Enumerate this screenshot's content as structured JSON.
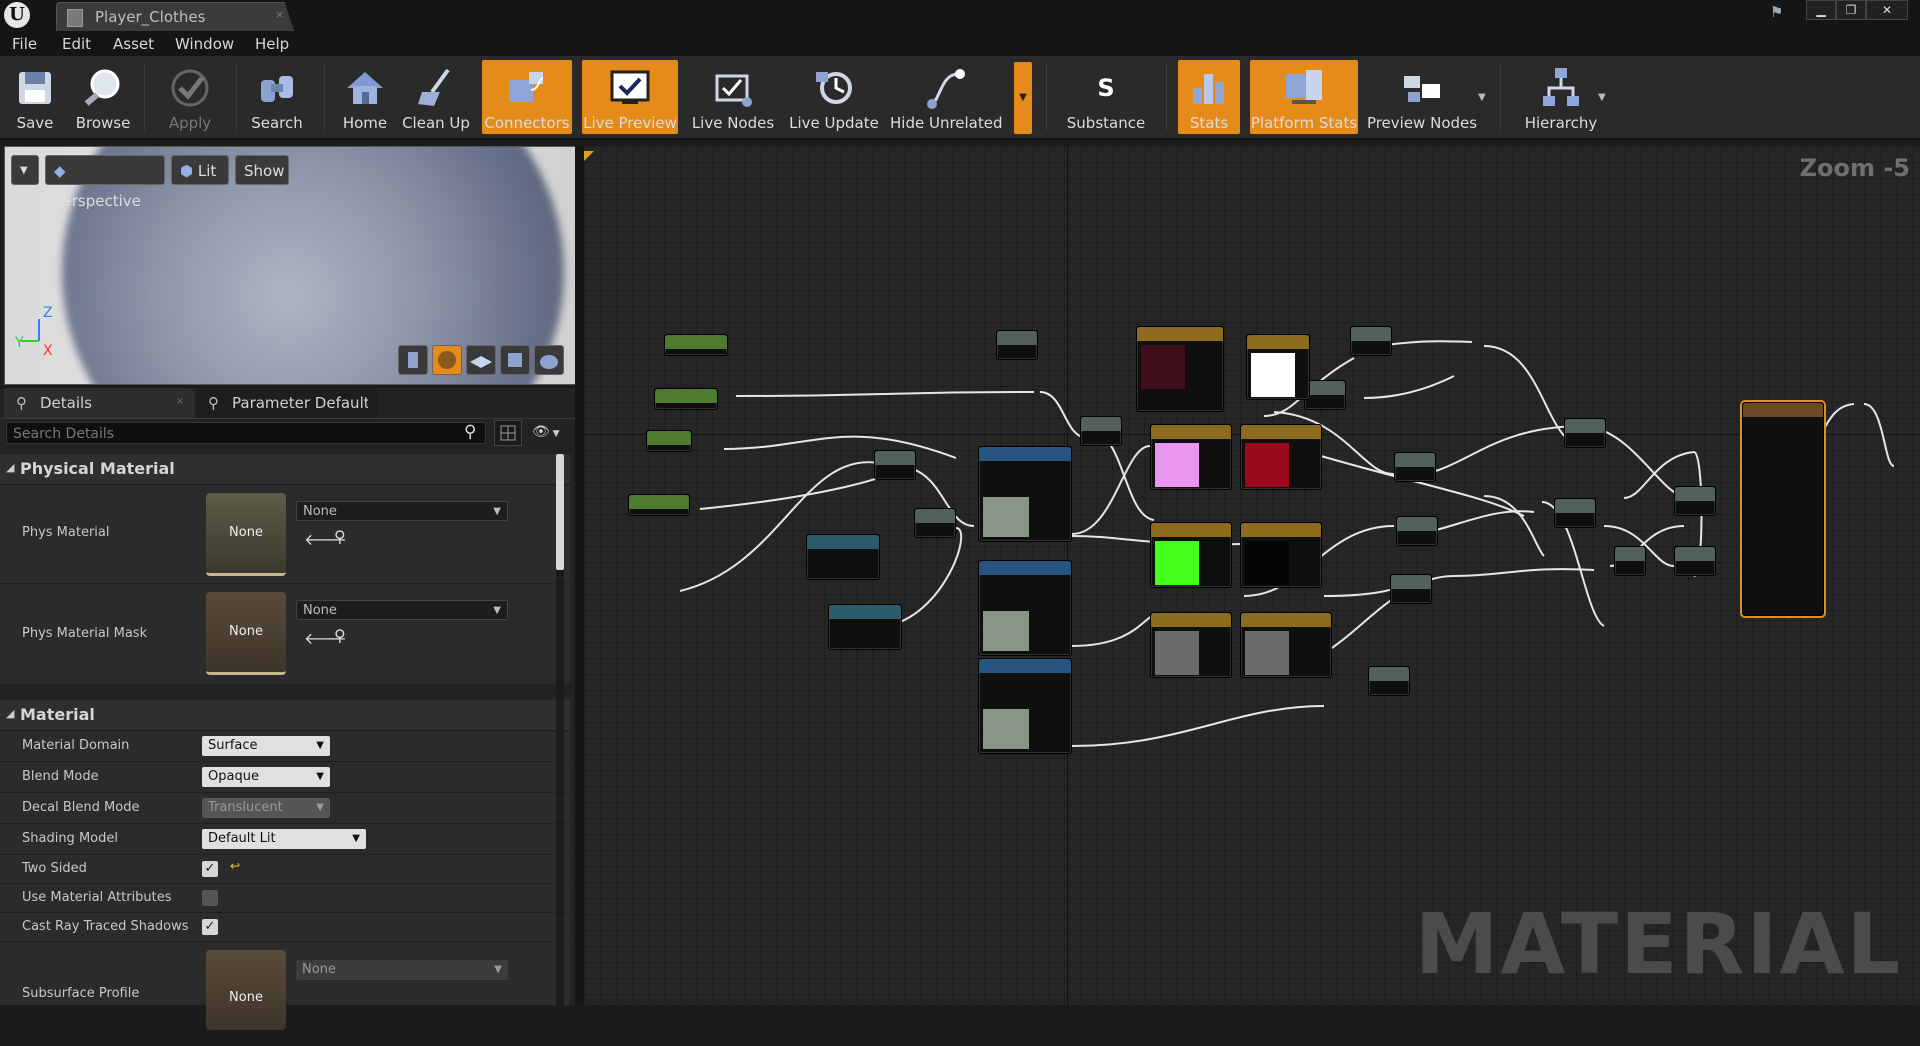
{
  "window": {
    "tab_title": "Player_Clothes",
    "close_glyph": "×",
    "controls": [
      "▁",
      "❐",
      "✕"
    ]
  },
  "menu": [
    "File",
    "Edit",
    "Asset",
    "Window",
    "Help"
  ],
  "toolbar": {
    "save": "Save",
    "browse": "Browse",
    "apply": "Apply",
    "search": "Search",
    "home": "Home",
    "clean_up": "Clean Up",
    "connectors": "Connectors",
    "live_preview": "Live Preview",
    "live_nodes": "Live Nodes",
    "live_update": "Live Update",
    "hide_unrelated": "Hide Unrelated",
    "substance": "Substance",
    "stats": "Stats",
    "platform_stats": "Platform Stats",
    "preview_nodes": "Preview Nodes",
    "hierarchy": "Hierarchy",
    "accent_color": "#e48b1a"
  },
  "viewport": {
    "perspective": "Perspective",
    "lit": "Lit",
    "show": "Show",
    "axis_z": "Z",
    "axis_x": "X",
    "axis_y": "Y"
  },
  "details": {
    "tab_details": "Details",
    "tab_params": "Parameter Defaults",
    "search_placeholder": "Search Details",
    "physical_material": {
      "title": "Physical Material",
      "phys_material": "Phys Material",
      "phys_material_value": "None",
      "phys_material_mask": "Phys Material Mask",
      "phys_material_mask_value": "None",
      "thumb_label": "None"
    },
    "material": {
      "title": "Material",
      "material_domain": "Material Domain",
      "material_domain_value": "Surface",
      "blend_mode": "Blend Mode",
      "blend_mode_value": "Opaque",
      "decal_blend_mode": "Decal Blend Mode",
      "decal_blend_mode_value": "Translucent",
      "shading_model": "Shading Model",
      "shading_model_value": "Default Lit",
      "two_sided": "Two Sided",
      "use_material_attributes": "Use Material Attributes",
      "cast_ray_traced_shadows": "Cast Ray Traced Shadows",
      "subsurface_profile": "Subsurface Profile",
      "subsurface_value": "None",
      "check": "✓"
    }
  },
  "graph": {
    "zoom": "Zoom -5",
    "watermark": "MATERIAL"
  }
}
